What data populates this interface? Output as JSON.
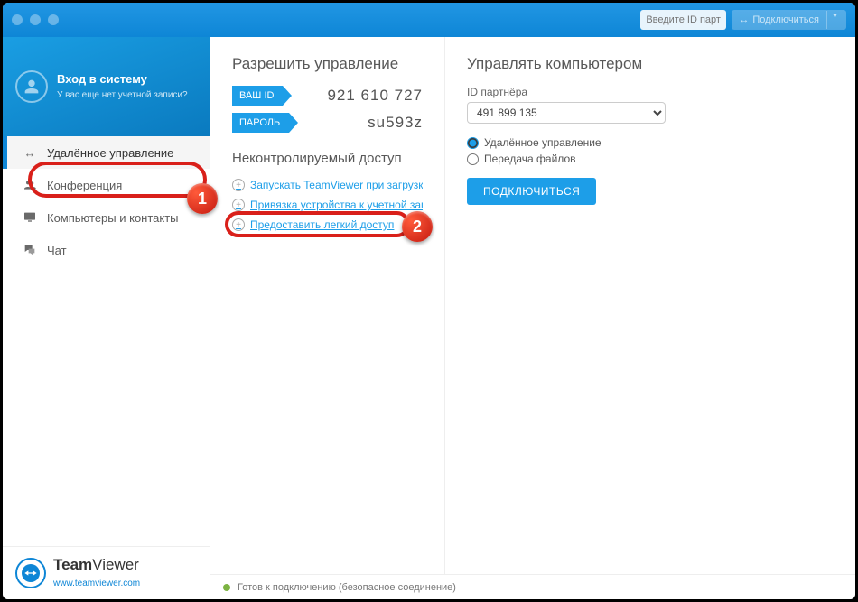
{
  "titlebar": {
    "partner_placeholder": "Введите ID партн",
    "connect_label": "Подключиться"
  },
  "sidebar": {
    "login_title": "Вход в систему",
    "login_sub": "У вас еще нет учетной записи?",
    "items": [
      {
        "label": "Удалённое управление"
      },
      {
        "label": "Конференция"
      },
      {
        "label": "Компьютеры и контакты"
      },
      {
        "label": "Чат"
      }
    ],
    "brand_strong": "Team",
    "brand_light": "Viewer",
    "brand_url": "www.teamviewer.com"
  },
  "allow": {
    "title": "Разрешить управление",
    "id_label": "ВАШ ID",
    "id_value": "921 610 727",
    "pw_label": "ПАРОЛЬ",
    "pw_value": "su593z"
  },
  "unattended": {
    "title": "Неконтролируемый доступ",
    "links": [
      "Запускать TeamViewer при загрузке с...",
      "Привязка устройства к учетной записи",
      "Предоставить легкий доступ"
    ]
  },
  "control": {
    "title": "Управлять компьютером",
    "partner_label": "ID партнёра",
    "partner_value": "491 899 135",
    "radio_remote": "Удалённое управление",
    "radio_file": "Передача файлов",
    "connect_btn": "ПОДКЛЮЧИТЬСЯ"
  },
  "status": {
    "text": "Готов к подключению (безопасное соединение)"
  },
  "badges": {
    "one": "1",
    "two": "2"
  }
}
